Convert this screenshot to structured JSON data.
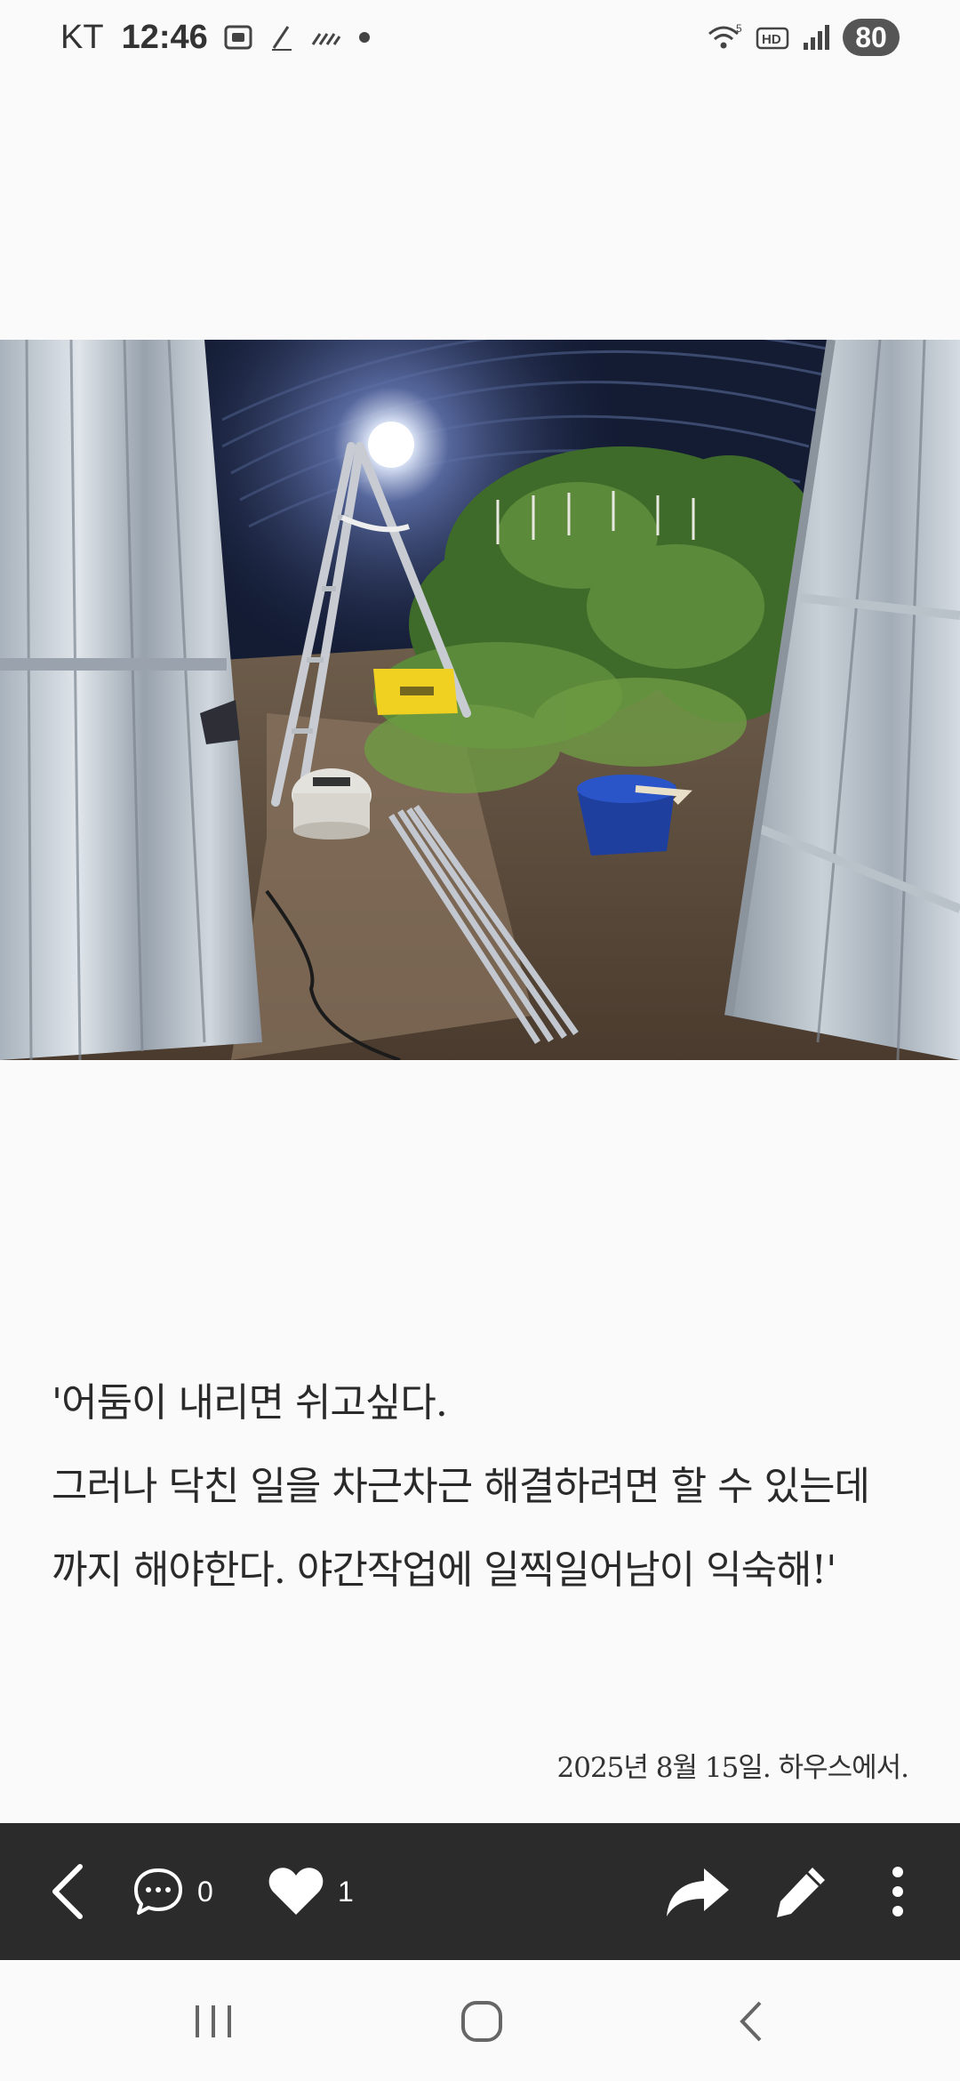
{
  "status_bar": {
    "carrier": "KT",
    "time": "12:46",
    "battery": "80",
    "icons": [
      "screenshot-icon",
      "pen-icon",
      "signal-slash-icon",
      "dot-icon",
      "wifi-icon",
      "hd-icon",
      "cell-signal-icon"
    ]
  },
  "post": {
    "lines": [
      "'어둠이 내리면 쉬고싶다.",
      "그러나 닥친 일을 차근차근 해결하려면 할 수 있는데",
      "까지 해야한다. 야간작업에 일찍일어남이 익숙해!'"
    ],
    "date_caption": "2025년 8월 15일. 하우스에서."
  },
  "actions": {
    "comment_count": "0",
    "like_count": "1"
  },
  "colors": {
    "action_bar": "#2b2b2b",
    "background": "#fafafa",
    "icon": "#ffffff"
  }
}
